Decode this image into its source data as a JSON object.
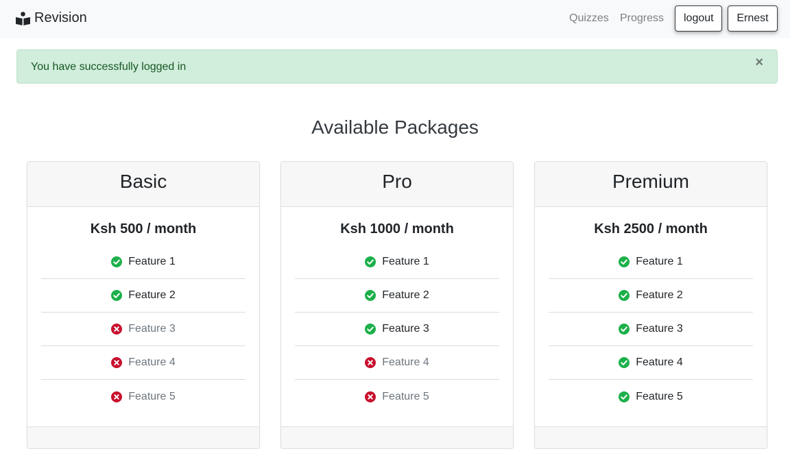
{
  "navbar": {
    "brand": "Revision",
    "brand_icon": "reader-icon",
    "links": [
      "Quizzes",
      "Progress"
    ],
    "logout_label": "logout",
    "user_label": "Ernest"
  },
  "alert": {
    "message": "You have successfully logged in",
    "close_symbol": "×"
  },
  "section_title": "Available Packages",
  "colors": {
    "included": "#1cb04a",
    "excluded": "#c8102e",
    "alert_bg": "#d1eddb"
  },
  "packages": [
    {
      "name": "Basic",
      "price": "Ksh 500 / month",
      "features": [
        {
          "label": "Feature 1",
          "included": true
        },
        {
          "label": "Feature 2",
          "included": true
        },
        {
          "label": "Feature 3",
          "included": false
        },
        {
          "label": "Feature 4",
          "included": false
        },
        {
          "label": "Feature 5",
          "included": false
        }
      ]
    },
    {
      "name": "Pro",
      "price": "Ksh 1000 / month",
      "features": [
        {
          "label": "Feature 1",
          "included": true
        },
        {
          "label": "Feature 2",
          "included": true
        },
        {
          "label": "Feature 3",
          "included": true
        },
        {
          "label": "Feature 4",
          "included": false
        },
        {
          "label": "Feature 5",
          "included": false
        }
      ]
    },
    {
      "name": "Premium",
      "price": "Ksh 2500 / month",
      "features": [
        {
          "label": "Feature 1",
          "included": true
        },
        {
          "label": "Feature 2",
          "included": true
        },
        {
          "label": "Feature 3",
          "included": true
        },
        {
          "label": "Feature 4",
          "included": true
        },
        {
          "label": "Feature 5",
          "included": true
        }
      ]
    }
  ]
}
